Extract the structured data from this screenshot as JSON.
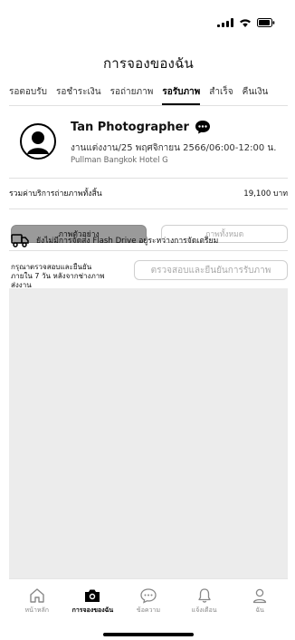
{
  "header": {
    "title": "การจองของฉัน"
  },
  "tabs": [
    {
      "label": "รอตอบรับ"
    },
    {
      "label": "รอชำระเงิน"
    },
    {
      "label": "รอถ่ายภาพ"
    },
    {
      "label": "รอรับภาพ",
      "active": true
    },
    {
      "label": "สำเร็จ"
    },
    {
      "label": "คืนเงิน"
    }
  ],
  "booking": {
    "photographer_name": "Tan Photographer",
    "event_line": "งานแต่งงาน/25 พฤศจิกายน 2566/06:00-12:00 น.",
    "venue": "Pullman Bangkok Hotel G",
    "total_label": "รวมค่าบริการถ่ายภาพทั้งสิ้น",
    "total_value": "19,100 บาท",
    "btn_sample": "ภาพตัวอย่าง",
    "btn_all": "ภาพทั้งหมด",
    "delivery_text": "ยังไม่มีการจัดส่ง Flash Drive อยู่ระหว่างการจัดเตรียม",
    "notice_text": "กรุณาตรวจสอบและยืนยันภายใน 7 วัน หลังจากช่างภาพส่งงาน",
    "confirm_btn": "ตรวจสอบและยืนยันการรับภาพ"
  },
  "nav": [
    {
      "label": "หน้าหลัก",
      "icon": "home-icon"
    },
    {
      "label": "การจองของฉัน",
      "icon": "camera-icon",
      "active": true
    },
    {
      "label": "ข้อความ",
      "icon": "chat-icon"
    },
    {
      "label": "แจ้งเตือน",
      "icon": "bell-icon"
    },
    {
      "label": "ฉัน",
      "icon": "user-icon"
    }
  ]
}
